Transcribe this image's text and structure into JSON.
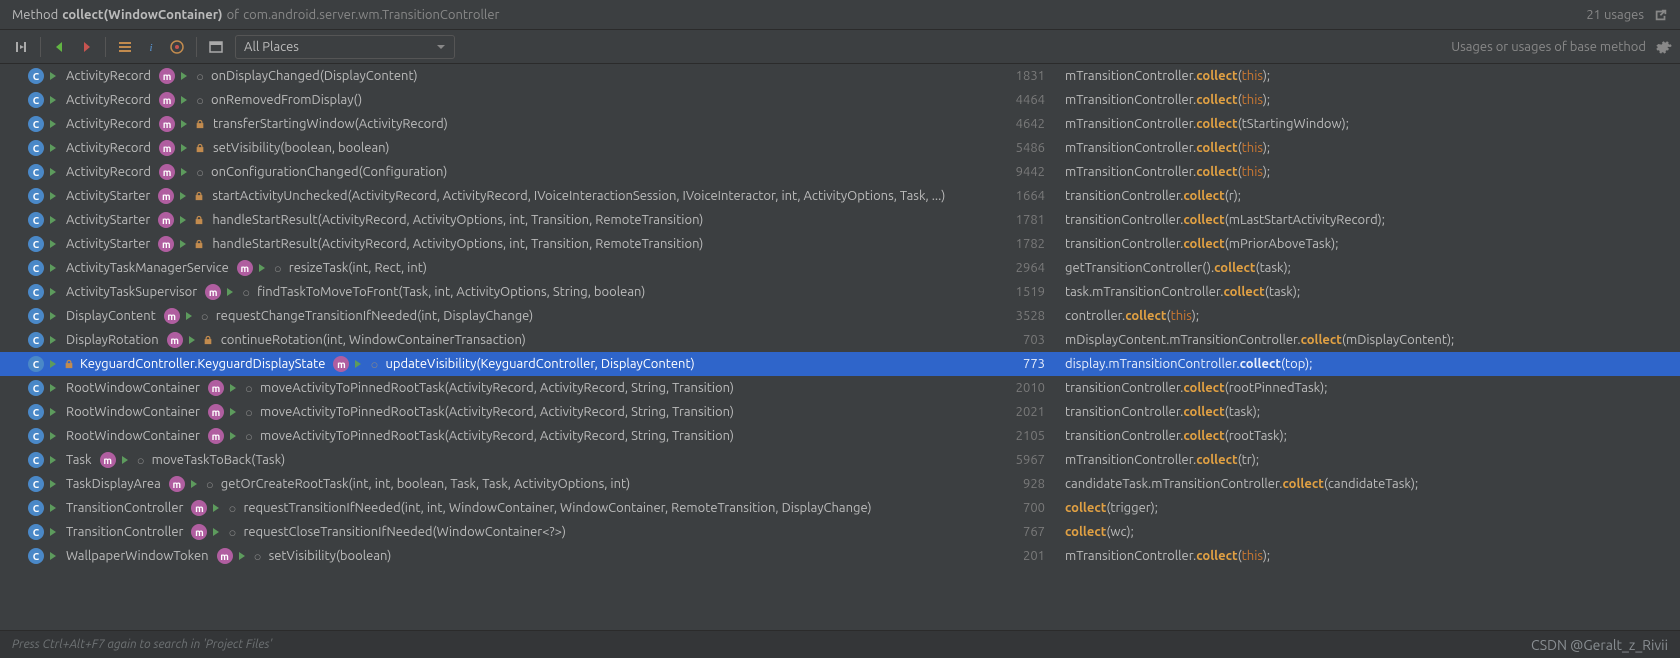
{
  "header": {
    "prefix": "Method",
    "signature": "collect(WindowContainer)",
    "of": "of",
    "class": "com.android.server.wm.TransitionController",
    "usages": "21 usages"
  },
  "toolbar": {
    "scope": "All Places",
    "right_label": "Usages or usages of base method"
  },
  "footer": {
    "hint": "Press Ctrl+Alt+F7 again to search in 'Project Files'",
    "watermark": "CSDN @Geralt_z_Rivii"
  },
  "rows": [
    {
      "cls": "ActivityRecord",
      "mlock": false,
      "method": "onDisplayChanged(DisplayContent)",
      "line": "1831",
      "pre": "mTransitionController.",
      "arg_kw": true,
      "arg": "this",
      "sel": false
    },
    {
      "cls": "ActivityRecord",
      "mlock": false,
      "method": "onRemovedFromDisplay()",
      "line": "4464",
      "pre": "mTransitionController.",
      "arg_kw": true,
      "arg": "this",
      "sel": false
    },
    {
      "cls": "ActivityRecord",
      "mlock": true,
      "method": "transferStartingWindow(ActivityRecord)",
      "line": "4642",
      "pre": "mTransitionController.",
      "arg_kw": false,
      "arg": "tStartingWindow",
      "sel": false
    },
    {
      "cls": "ActivityRecord",
      "mlock": true,
      "method": "setVisibility(boolean, boolean)",
      "line": "5486",
      "pre": "mTransitionController.",
      "arg_kw": true,
      "arg": "this",
      "sel": false
    },
    {
      "cls": "ActivityRecord",
      "mlock": false,
      "method": "onConfigurationChanged(Configuration)",
      "line": "9442",
      "pre": "mTransitionController.",
      "arg_kw": true,
      "arg": "this",
      "sel": false
    },
    {
      "cls": "ActivityStarter",
      "mlock": true,
      "method": "startActivityUnchecked(ActivityRecord, ActivityRecord, IVoiceInteractionSession, IVoiceInteractor, int, ActivityOptions, Task, ...)",
      "line": "1664",
      "pre": "transitionController.",
      "arg_kw": false,
      "arg": "r",
      "sel": false
    },
    {
      "cls": "ActivityStarter",
      "mlock": true,
      "method": "handleStartResult(ActivityRecord, ActivityOptions, int, Transition, RemoteTransition)",
      "line": "1781",
      "pre": "transitionController.",
      "arg_kw": false,
      "arg": "mLastStartActivityRecord",
      "sel": false
    },
    {
      "cls": "ActivityStarter",
      "mlock": true,
      "method": "handleStartResult(ActivityRecord, ActivityOptions, int, Transition, RemoteTransition)",
      "line": "1782",
      "pre": "transitionController.",
      "arg_kw": false,
      "arg": "mPriorAboveTask",
      "sel": false
    },
    {
      "cls": "ActivityTaskManagerService",
      "mlock": false,
      "method": "resizeTask(int, Rect, int)",
      "line": "2964",
      "pre": "getTransitionController().",
      "arg_kw": false,
      "arg": "task",
      "sel": false
    },
    {
      "cls": "ActivityTaskSupervisor",
      "mlock": false,
      "method": "findTaskToMoveToFront(Task, int, ActivityOptions, String, boolean)",
      "line": "1519",
      "pre": "task.mTransitionController.",
      "arg_kw": false,
      "arg": "task",
      "sel": false
    },
    {
      "cls": "DisplayContent",
      "mlock": false,
      "method": "requestChangeTransitionIfNeeded(int, DisplayChange)",
      "line": "3528",
      "pre": "controller.",
      "arg_kw": true,
      "arg": "this",
      "sel": false
    },
    {
      "cls": "DisplayRotation",
      "mlock": true,
      "method": "continueRotation(int, WindowContainerTransaction)",
      "line": "703",
      "pre": "mDisplayContent.mTransitionController.",
      "arg_kw": false,
      "arg": "mDisplayContent",
      "sel": false
    },
    {
      "cls": "KeyguardController.KeyguardDisplayState",
      "mlock": false,
      "method": "updateVisibility(KeyguardController, DisplayContent)",
      "line": "773",
      "pre": "display.mTransitionController.",
      "arg_kw": false,
      "arg": "top",
      "sel": true,
      "clock": true
    },
    {
      "cls": "RootWindowContainer",
      "mlock": false,
      "method": "moveActivityToPinnedRootTask(ActivityRecord, ActivityRecord, String, Transition)",
      "line": "2010",
      "pre": "transitionController.",
      "arg_kw": false,
      "arg": "rootPinnedTask",
      "sel": false
    },
    {
      "cls": "RootWindowContainer",
      "mlock": false,
      "method": "moveActivityToPinnedRootTask(ActivityRecord, ActivityRecord, String, Transition)",
      "line": "2021",
      "pre": "transitionController.",
      "arg_kw": false,
      "arg": "task",
      "sel": false
    },
    {
      "cls": "RootWindowContainer",
      "mlock": false,
      "method": "moveActivityToPinnedRootTask(ActivityRecord, ActivityRecord, String, Transition)",
      "line": "2105",
      "pre": "transitionController.",
      "arg_kw": false,
      "arg": "rootTask",
      "sel": false
    },
    {
      "cls": "Task",
      "mlock": false,
      "method": "moveTaskToBack(Task)",
      "line": "5967",
      "pre": "mTransitionController.",
      "arg_kw": false,
      "arg": "tr",
      "sel": false
    },
    {
      "cls": "TaskDisplayArea",
      "mlock": false,
      "method": "getOrCreateRootTask(int, int, boolean, Task, Task, ActivityOptions, int)",
      "line": "928",
      "pre": "candidateTask.mTransitionController.",
      "arg_kw": false,
      "arg": "candidateTask",
      "sel": false
    },
    {
      "cls": "TransitionController",
      "mlock": false,
      "method": "requestTransitionIfNeeded(int, int, WindowContainer, WindowContainer, RemoteTransition, DisplayChange)",
      "line": "700",
      "pre": "",
      "arg_kw": false,
      "arg": "trigger",
      "sel": false
    },
    {
      "cls": "TransitionController",
      "mlock": false,
      "method": "requestCloseTransitionIfNeeded(WindowContainer<?>)",
      "line": "767",
      "pre": "",
      "arg_kw": false,
      "arg": "wc",
      "sel": false
    },
    {
      "cls": "WallpaperWindowToken",
      "mlock": false,
      "method": "setVisibility(boolean)",
      "line": "201",
      "pre": "mTransitionController.",
      "arg_kw": true,
      "arg": "this",
      "sel": false
    }
  ]
}
